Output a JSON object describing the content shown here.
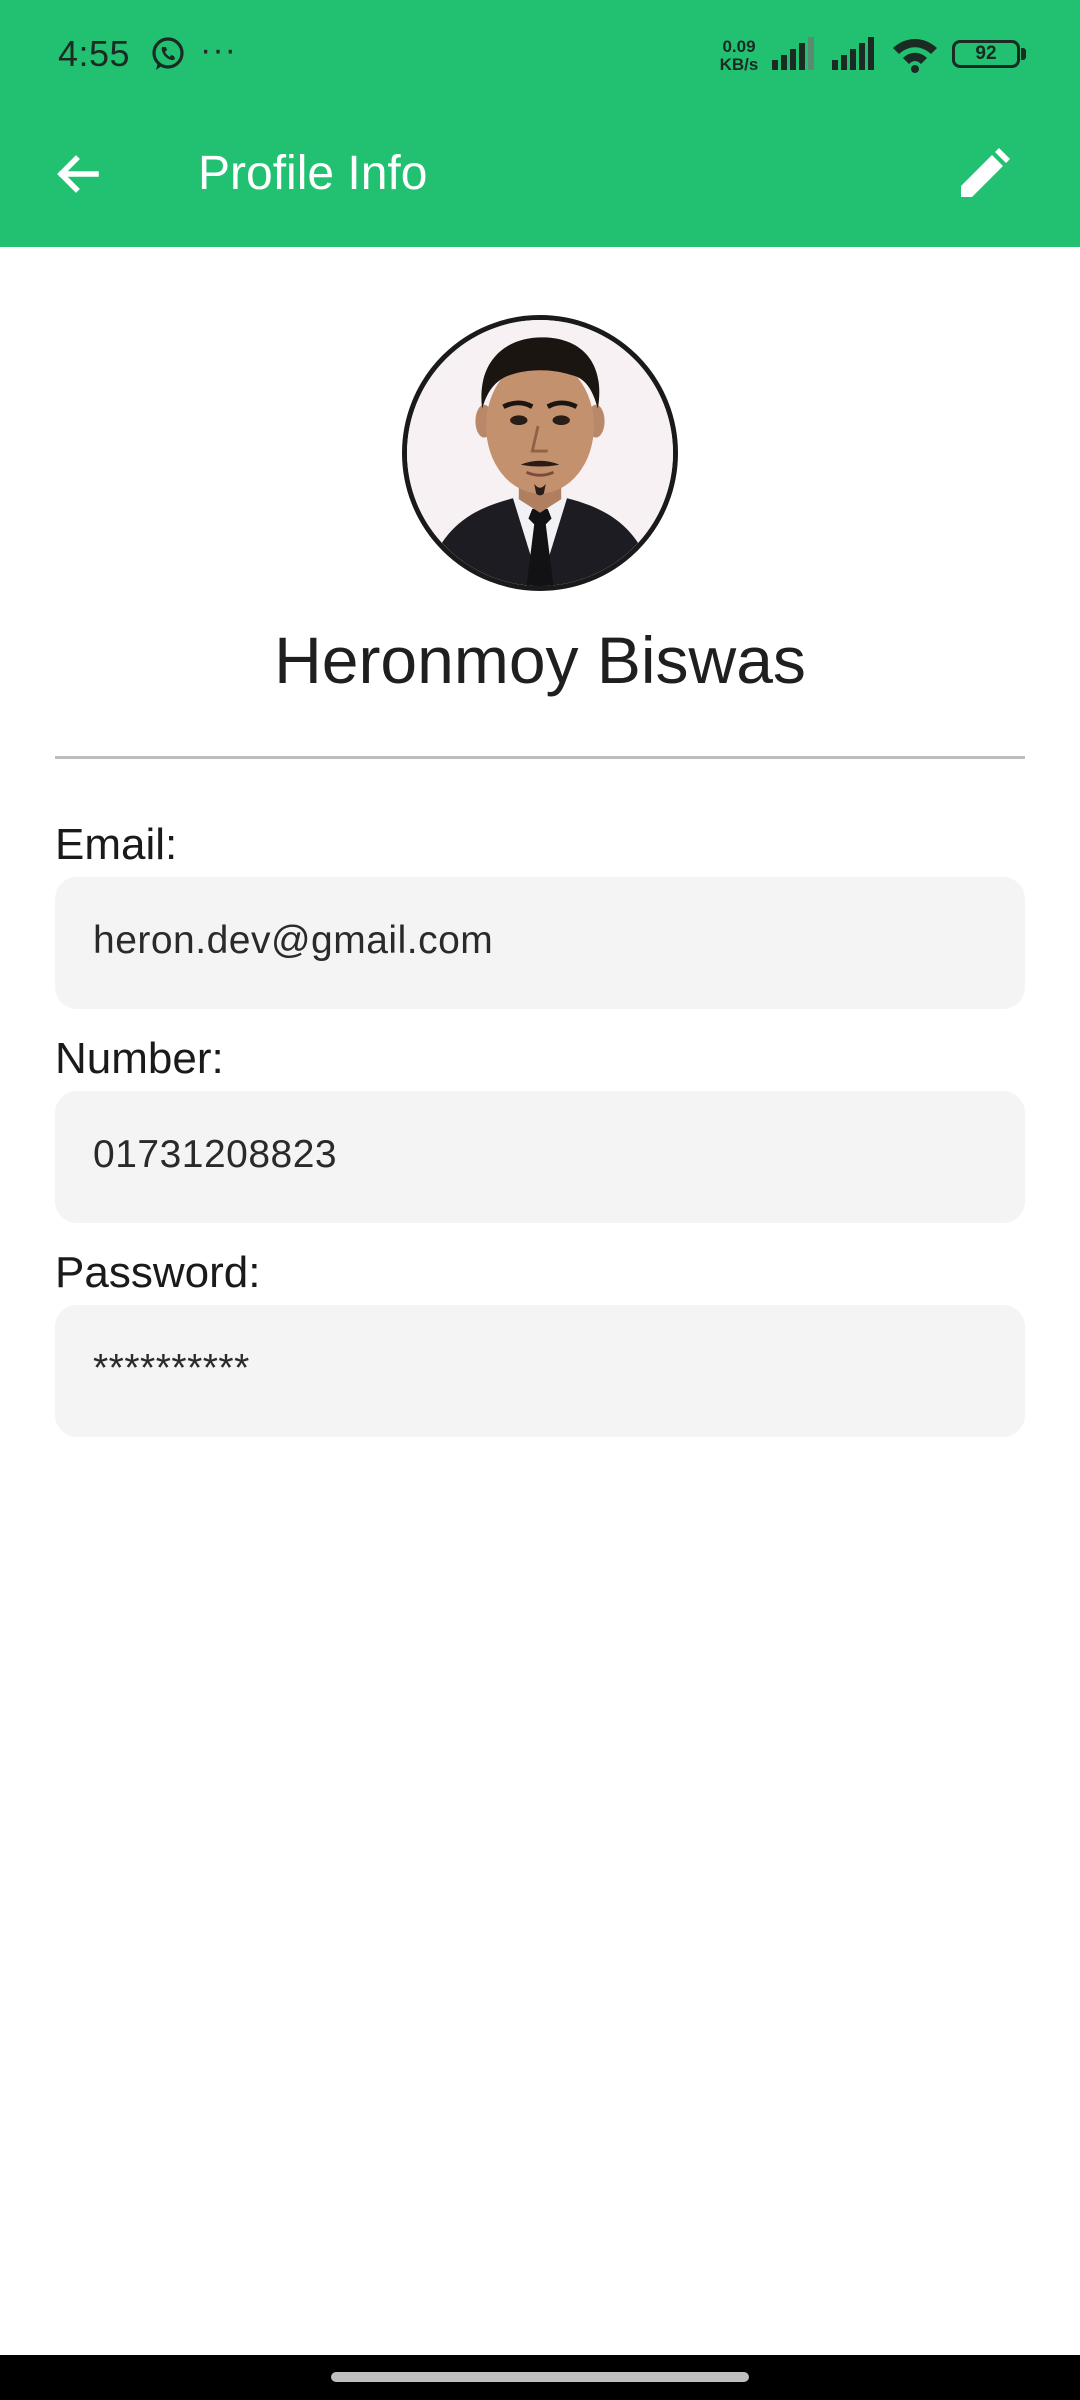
{
  "status_bar": {
    "time": "4:55",
    "more": "···",
    "speed_value": "0.09",
    "speed_unit": "KB/s",
    "battery": "92",
    "icons": [
      "whatsapp-icon",
      "signal-icon",
      "signal-icon",
      "wifi-icon",
      "battery-icon"
    ]
  },
  "app_bar": {
    "title": "Profile Info",
    "back_icon": "arrow-left-icon",
    "edit_icon": "pencil-icon"
  },
  "profile": {
    "name": "Heronmoy Biswas"
  },
  "fields": {
    "email_label": "Email:",
    "email_value": "heron.dev@gmail.com",
    "number_label": "Number:",
    "number_value": "01731208823",
    "password_label": "Password:",
    "password_value": "**********"
  },
  "colors": {
    "primary": "#22c172",
    "field_bg": "#f4f4f4",
    "divider": "#bdbdbd"
  }
}
